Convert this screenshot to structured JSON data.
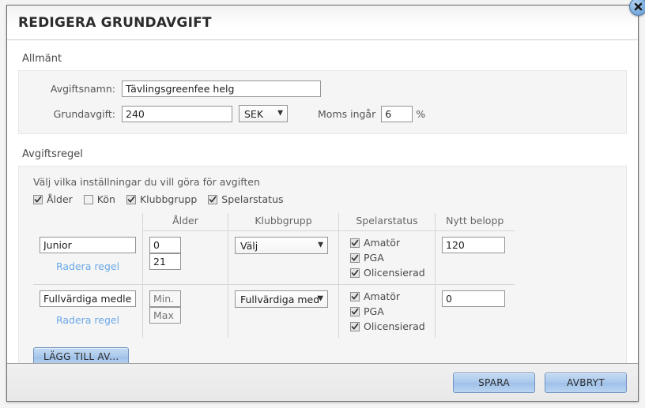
{
  "dialog": {
    "title": "REDIGERA GRUNDAVGIFT",
    "close_icon": "close-icon"
  },
  "general": {
    "legend": "Allmänt",
    "fee_name_label": "Avgiftsnamn:",
    "fee_name_value": "Tävlingsgreenfee helg",
    "base_fee_label": "Grundavgift:",
    "base_fee_value": "240",
    "currency_value": "SEK",
    "vat_label": "Moms ingår",
    "vat_value": "6",
    "percent_sign": "%"
  },
  "rule": {
    "legend": "Avgiftsregel",
    "intro": "Välj vilka inställningar du vill göra för avgiften",
    "toggles": [
      {
        "label": "Ålder",
        "checked": true
      },
      {
        "label": "Kön",
        "checked": false
      },
      {
        "label": "Klubbgrupp",
        "checked": true
      },
      {
        "label": "Spelarstatus",
        "checked": true
      }
    ],
    "headers": {
      "name": "",
      "age": "Ålder",
      "group": "Klubbgrupp",
      "status": "Spelarstatus",
      "amount": "Nytt belopp"
    },
    "delete_label": "Radera regel",
    "rows": [
      {
        "name_value": "Junior",
        "name_placeholder": "",
        "age_min_value": "0",
        "age_min_placeholder": "Min.",
        "age_max_value": "21",
        "age_max_placeholder": "Max",
        "group_value": "Välj",
        "amount_value": "120",
        "statuses": [
          {
            "label": "Amatör",
            "checked": true
          },
          {
            "label": "PGA",
            "checked": true
          },
          {
            "label": "Olicensierad",
            "checked": true
          }
        ]
      },
      {
        "name_value": "Fullvärdiga medlemmar",
        "name_placeholder": "",
        "age_min_value": "",
        "age_min_placeholder": "Min.",
        "age_max_value": "",
        "age_max_placeholder": "Max",
        "group_value": "Fullvärdiga med",
        "amount_value": "0",
        "statuses": [
          {
            "label": "Amatör",
            "checked": true
          },
          {
            "label": "PGA",
            "checked": true
          },
          {
            "label": "Olicensierad",
            "checked": true
          }
        ]
      }
    ],
    "add_button_label": "LÄGG TILL AV..."
  },
  "footer": {
    "save_label": "SPARA",
    "cancel_label": "AVBRYT"
  },
  "colors": {
    "link": "#6aa8e8",
    "button_blue": "#a9c8ec",
    "border": "#949494"
  }
}
